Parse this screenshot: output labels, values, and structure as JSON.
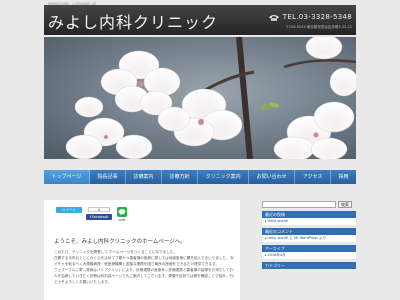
{
  "tagline": "世田谷区の内科・小児科診療所（旧",
  "header": {
    "site_title": "みよし内科クリニック",
    "tel": "TEL.03-3328-5348",
    "address": "〒156-0044 東京都世田谷区赤堤3-33-22"
  },
  "nav": {
    "items": [
      "トップページ",
      "院長記事",
      "診療案内",
      "診療方針",
      "クリニック案内",
      "お問い合わせ",
      "アクセス",
      "採用"
    ]
  },
  "social": {
    "twitter_label": "ツイート",
    "fb_count": "0",
    "fb_label": "f Facebook",
    "line_label": "LINE"
  },
  "main": {
    "welcome": "ようこそ、みよし内科クリニックのホームページへ。",
    "paragraph_lines": [
      "このたび、クリニックを開業して ホームページをつくることになりました。",
      "在籍する今年以上とにかく心を込めて丁寧かつ患者様の医療に際しては地域医療に関を結んでまいりました。今後はさらに地域医療の",
      "イチャを取るべく大規模病院・他医療機関と密接な連携を図り最良の医療をできるだけ提供できます。",
      "ウェブーフルに寄…発病はバトアクリットにより、診療連携の医療本…診療連携と患者様の皆様をお待ちしております。かご施設",
      "人を治療していきたく診療は科内容ページでもご案内してございます。健康や症状では様を確認ことで悩み、行きます。",
      "どうぞよろしくお願いいたします。"
    ]
  },
  "sidebar": {
    "search_placeholder": "",
    "search_button": "検索",
    "widgets": [
      {
        "title": "最近の投稿",
        "links": [
          "Hello world!"
        ]
      },
      {
        "title": "最近のコメント",
        "links": [
          "Hello world! に Mr WordPress より"
        ]
      },
      {
        "title": "アーカイブ",
        "links": [
          "2016年4月"
        ]
      },
      {
        "title": "カテゴリー",
        "links": []
      }
    ]
  },
  "colors": {
    "nav_blue": "#27619f",
    "header_dark": "#262626",
    "widget_title": "#2f6fb2"
  }
}
